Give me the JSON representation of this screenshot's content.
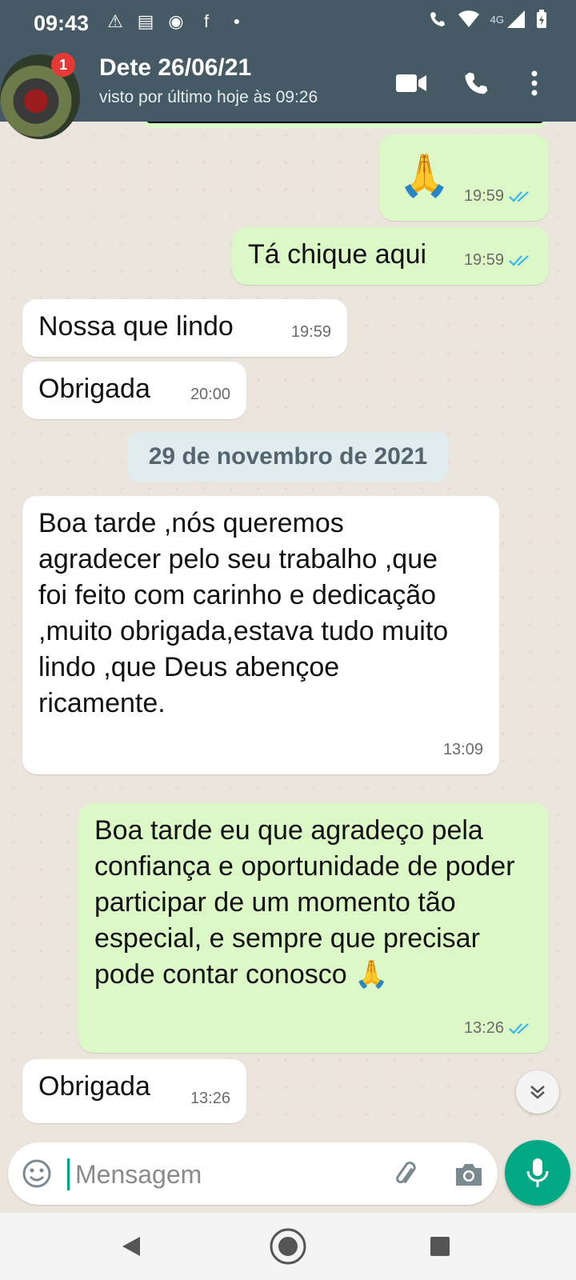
{
  "status_bar": {
    "time": "09:43",
    "left_icons": [
      "alert-icon",
      "news-icon",
      "messenger-icon",
      "facebook-icon",
      "dot-icon"
    ],
    "network": "4G"
  },
  "header": {
    "badge_count": "1",
    "contact_name": "Dete 26/06/21",
    "last_seen": "visto por último hoje às 09:26"
  },
  "messages": [
    {
      "dir": "out",
      "text": "🙏",
      "time": "19:59",
      "read": true
    },
    {
      "dir": "out",
      "text": "Tá chique aqui",
      "time": "19:59",
      "read": true
    },
    {
      "dir": "in",
      "text": "Nossa que lindo",
      "time": "19:59"
    },
    {
      "dir": "in",
      "text": "Obrigada",
      "time": "20:00"
    },
    {
      "dir": "in",
      "text": "Boa tarde ,nós queremos agradecer pelo seu trabalho ,que foi feito com carinho e dedicação  ,muito obrigada,estava tudo muito lindo ,que Deus abençoe ricamente.",
      "time": "13:09"
    },
    {
      "dir": "out",
      "text": "Boa tarde eu que agradeço pela confiança e oportunidade de poder participar de um momento tão especial, e sempre que precisar pode contar conosco 🙏",
      "time": "13:26",
      "read": true
    },
    {
      "dir": "in",
      "text": "Obrigada",
      "time": "13:26"
    }
  ],
  "date_divider": "29 de novembro de 2021",
  "composer": {
    "placeholder": "Mensagem"
  },
  "colors": {
    "header": "#455a64",
    "outgoing": "#dcf8c6",
    "accent": "#00a884",
    "read_ticks": "#34b7f1"
  }
}
